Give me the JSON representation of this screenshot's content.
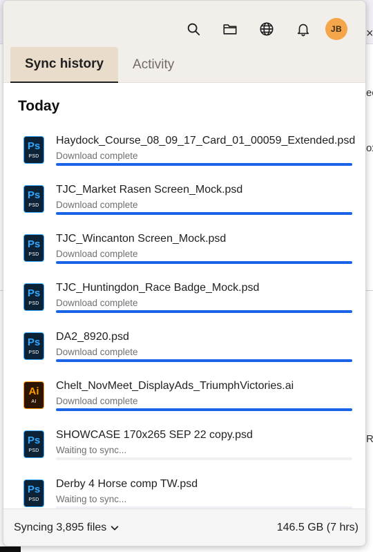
{
  "toolbar": {
    "icons": [
      "search-icon",
      "folder-icon",
      "globe-icon",
      "bell-icon"
    ],
    "avatar_initials": "JB",
    "avatar_color": "#f5a54a"
  },
  "tabs": [
    {
      "label": "Sync history",
      "active": true
    },
    {
      "label": "Activity",
      "active": false
    }
  ],
  "section_title": "Today",
  "files": [
    {
      "name": "Haydock_Course_08_09_17_Card_01_00059_Extended.psd",
      "type": "PSD",
      "status": "Download complete",
      "progress": 1
    },
    {
      "name": "TJC_Market Rasen Screen_Mock.psd",
      "type": "PSD",
      "status": "Download complete",
      "progress": 1
    },
    {
      "name": "TJC_Wincanton Screen_Mock.psd",
      "type": "PSD",
      "status": "Download complete",
      "progress": 1
    },
    {
      "name": "TJC_Huntingdon_Race Badge_Mock.psd",
      "type": "PSD",
      "status": "Download complete",
      "progress": 1
    },
    {
      "name": "DA2_8920.psd",
      "type": "PSD",
      "status": "Download complete",
      "progress": 1
    },
    {
      "name": "Chelt_NovMeet_DisplayAds_TriumphVictories.ai",
      "type": "AI",
      "status": "Download complete",
      "progress": 1
    },
    {
      "name": "SHOWCASE 170x265 SEP 22 copy.psd",
      "type": "PSD",
      "status": "Waiting to sync...",
      "progress": 0
    },
    {
      "name": "Derby 4 Horse comp TW.psd",
      "type": "PSD",
      "status": "Waiting to sync...",
      "progress": 0
    }
  ],
  "icon_glyphs": {
    "PSD": "Ps",
    "AI": "Ai"
  },
  "footer": {
    "sync_label": "Syncing 3,895 files",
    "usage": "146.5 GB (7 hrs)"
  },
  "background_fragments": {
    "close_glyph": "×",
    "frag_ed": "ed",
    "frag_x": "ox",
    "frag_re": "RE"
  },
  "colors": {
    "accent": "#1a63e8",
    "header_bg": "#f2efeb",
    "active_tab_bg": "#e9dccb",
    "ps_blue": "#31a8ff",
    "ai_orange": "#ff9a00"
  }
}
